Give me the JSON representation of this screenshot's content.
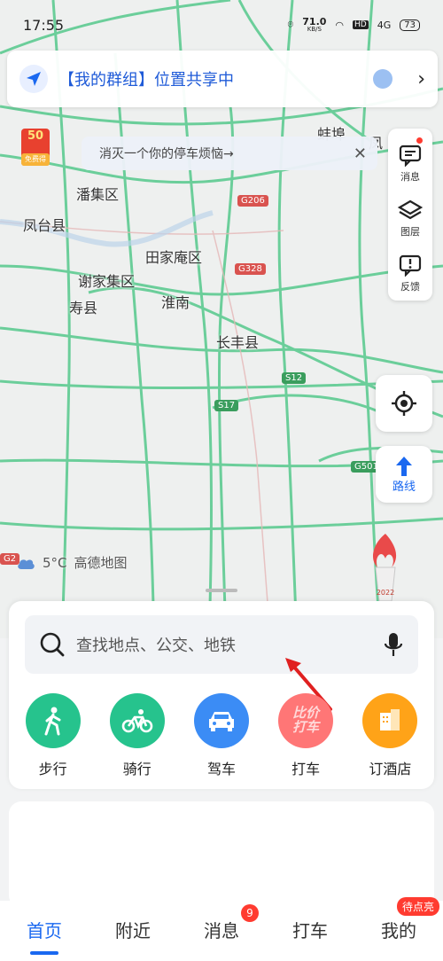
{
  "status_bar": {
    "time": "17:55",
    "net_speed": "71.0",
    "net_unit": "KB/S",
    "hd": "HD",
    "signal": "4G",
    "battery": "73"
  },
  "group_banner": {
    "text": "【我的群组】位置共享中"
  },
  "parking_tip": {
    "text": "消灭一个你的停车烦恼→"
  },
  "coupon": {
    "amount": "50",
    "label": "免费得"
  },
  "tools": {
    "messages": "消息",
    "layers": "图层",
    "feedback": "反馈"
  },
  "route_button": "路线",
  "map": {
    "places": [
      "潘集区",
      "凤台县",
      "田家庵区",
      "谢家集区",
      "寿县",
      "淮南",
      "长丰县",
      "蚌埠",
      "凤"
    ],
    "shields": [
      "G206",
      "G328",
      "S12",
      "S17",
      "G501",
      "G2"
    ]
  },
  "weather": {
    "temp": "5°C",
    "brand": "高德地图"
  },
  "torch_year": "2022",
  "search": {
    "placeholder": "查找地点、公交、地铁"
  },
  "shortcuts": [
    {
      "label": "步行",
      "color": "#26c38d"
    },
    {
      "label": "骑行",
      "color": "#26c38d"
    },
    {
      "label": "驾车",
      "color": "#3b8cf5"
    },
    {
      "label": "打车",
      "color": "#ff6b6b",
      "icon_text": "比价打车"
    },
    {
      "label": "订酒店",
      "color": "#ffa318"
    }
  ],
  "bottom_nav": [
    {
      "label": "首页",
      "active": true
    },
    {
      "label": "附近"
    },
    {
      "label": "消息",
      "badge": "9"
    },
    {
      "label": "打车"
    },
    {
      "label": "我的",
      "pill": "待点亮"
    }
  ],
  "colors": {
    "accent": "#1a68f0",
    "road": "#3dba7a"
  }
}
